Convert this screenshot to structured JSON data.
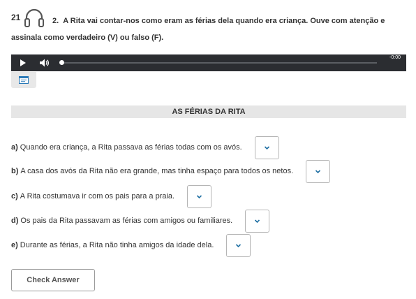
{
  "question": {
    "page_number": "21",
    "number": "2.",
    "instruction": "A Rita vai contar-nos como eram as férias dela quando era criança. Ouve com atenção e assinala como verdadeiro (V) ou falso (F)."
  },
  "player": {
    "time": "-0:00",
    "progress": 0
  },
  "section": {
    "title": "AS FÉRIAS DA RITA"
  },
  "items": [
    {
      "letter": "a)",
      "text": "Quando era criança, a Rita passava as férias todas com os avós."
    },
    {
      "letter": "b)",
      "text": "A casa dos avós da Rita não era grande, mas tinha espaço para todos os netos."
    },
    {
      "letter": "c)",
      "text": "A Rita costumava ir com os pais para a praia."
    },
    {
      "letter": "d)",
      "text": "Os pais da Rita passavam as férias com amigos ou familiares."
    },
    {
      "letter": "e)",
      "text": "Durante as férias, a Rita não tinha amigos da idade dela."
    }
  ],
  "check_button": {
    "label": "Check Answer"
  },
  "colors": {
    "player_bg": "#2b2d31",
    "section_bar_bg": "#e6e6e6",
    "chevron": "#1f6fa3"
  },
  "icons": {
    "audio": "headphones-icon",
    "play": "play-icon",
    "volume": "volume-icon",
    "transcript": "transcript-icon",
    "dropdown": "chevron-down-icon"
  }
}
